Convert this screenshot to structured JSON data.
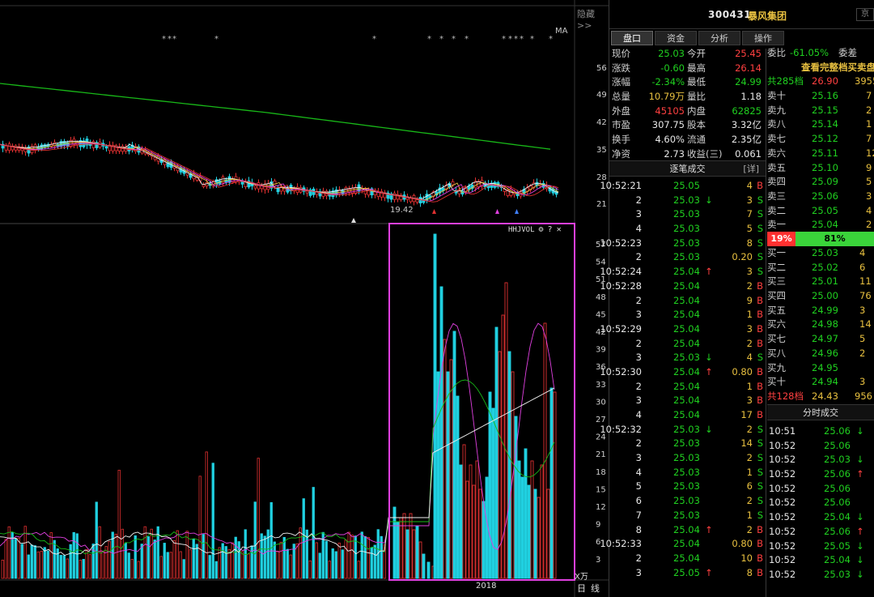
{
  "stock": {
    "code": "300431",
    "name": "暴风集团",
    "corner": "京"
  },
  "tabs": [
    "盘口",
    "资金",
    "分析",
    "操作"
  ],
  "quote": [
    {
      "l1": "现价",
      "v1": "25.03",
      "c1": "grn",
      "l2": "今开",
      "v2": "25.45",
      "c2": "red"
    },
    {
      "l1": "涨跌",
      "v1": "-0.60",
      "c1": "grn",
      "l2": "最高",
      "v2": "26.14",
      "c2": "red"
    },
    {
      "l1": "涨幅",
      "v1": "-2.34%",
      "c1": "grn",
      "l2": "最低",
      "v2": "24.99",
      "c2": "grn"
    },
    {
      "l1": "总量",
      "v1": "10.79万",
      "c1": "yel",
      "l2": "量比",
      "v2": "1.18",
      "c2": "wht"
    },
    {
      "l1": "外盘",
      "v1": "45105",
      "c1": "red",
      "l2": "内盘",
      "v2": "62825",
      "c2": "grn"
    },
    {
      "l1": "市盈",
      "v1": "307.75",
      "c1": "wht",
      "l2": "股本",
      "v2": "3.32亿",
      "c2": "wht"
    },
    {
      "l1": "换手",
      "v1": "4.60%",
      "c1": "wht",
      "l2": "流通",
      "v2": "2.35亿",
      "c2": "wht"
    },
    {
      "l1": "净资",
      "v1": "2.73",
      "c1": "wht",
      "l2": "收益(三)",
      "v2": "0.061",
      "c2": "wht"
    }
  ],
  "ticks_header": {
    "title": "逐笔成交",
    "detail": "[详]"
  },
  "ticks": [
    {
      "t": "10:52:21",
      "p": "25.05",
      "a": "",
      "v": "4",
      "s": "B"
    },
    {
      "t": "2",
      "p": "25.03",
      "a": "↓",
      "v": "3",
      "s": "S"
    },
    {
      "t": "3",
      "p": "25.03",
      "a": "",
      "v": "7",
      "s": "S"
    },
    {
      "t": "4",
      "p": "25.03",
      "a": "",
      "v": "5",
      "s": "S"
    },
    {
      "t": "10:52:23",
      "p": "25.03",
      "a": "",
      "v": "8",
      "s": "S"
    },
    {
      "t": "2",
      "p": "25.03",
      "a": "",
      "v": "0.20",
      "s": "S"
    },
    {
      "t": "10:52:24",
      "p": "25.04",
      "a": "↑",
      "v": "3",
      "s": "S"
    },
    {
      "t": "10:52:28",
      "p": "25.04",
      "a": "",
      "v": "2",
      "s": "B"
    },
    {
      "t": "2",
      "p": "25.04",
      "a": "",
      "v": "9",
      "s": "B"
    },
    {
      "t": "3",
      "p": "25.04",
      "a": "",
      "v": "1",
      "s": "B"
    },
    {
      "t": "10:52:29",
      "p": "25.04",
      "a": "",
      "v": "3",
      "s": "B"
    },
    {
      "t": "2",
      "p": "25.04",
      "a": "",
      "v": "2",
      "s": "B"
    },
    {
      "t": "3",
      "p": "25.03",
      "a": "↓",
      "v": "4",
      "s": "S"
    },
    {
      "t": "10:52:30",
      "p": "25.04",
      "a": "↑",
      "v": "0.80",
      "s": "B"
    },
    {
      "t": "2",
      "p": "25.04",
      "a": "",
      "v": "1",
      "s": "B"
    },
    {
      "t": "3",
      "p": "25.04",
      "a": "",
      "v": "3",
      "s": "B"
    },
    {
      "t": "4",
      "p": "25.04",
      "a": "",
      "v": "17",
      "s": "B"
    },
    {
      "t": "10:52:32",
      "p": "25.03",
      "a": "↓",
      "v": "2",
      "s": "S"
    },
    {
      "t": "2",
      "p": "25.03",
      "a": "",
      "v": "14",
      "s": "S"
    },
    {
      "t": "3",
      "p": "25.03",
      "a": "",
      "v": "2",
      "s": "S"
    },
    {
      "t": "4",
      "p": "25.03",
      "a": "",
      "v": "1",
      "s": "S"
    },
    {
      "t": "5",
      "p": "25.03",
      "a": "",
      "v": "6",
      "s": "S"
    },
    {
      "t": "6",
      "p": "25.03",
      "a": "",
      "v": "2",
      "s": "S"
    },
    {
      "t": "7",
      "p": "25.03",
      "a": "",
      "v": "1",
      "s": "S"
    },
    {
      "t": "8",
      "p": "25.04",
      "a": "↑",
      "v": "2",
      "s": "B"
    },
    {
      "t": "10:52:33",
      "p": "25.04",
      "a": "",
      "v": "0.80",
      "s": "B"
    },
    {
      "t": "2",
      "p": "25.04",
      "a": "",
      "v": "10",
      "s": "B"
    },
    {
      "t": "3",
      "p": "25.05",
      "a": "↑",
      "v": "8",
      "s": "B"
    }
  ],
  "orderbook": {
    "weibi": {
      "l1": "委比",
      "v1": "-61.05%",
      "l2": "委差"
    },
    "full_link": "查看完整档买卖盘",
    "sell_total": {
      "l": "共285档",
      "p": "26.90",
      "v": "3955"
    },
    "sells": [
      {
        "l": "卖十",
        "p": "25.16",
        "v": "7"
      },
      {
        "l": "卖九",
        "p": "25.15",
        "v": "2"
      },
      {
        "l": "卖八",
        "p": "25.14",
        "v": "1"
      },
      {
        "l": "卖七",
        "p": "25.12",
        "v": "7"
      },
      {
        "l": "卖六",
        "p": "25.11",
        "v": "12"
      },
      {
        "l": "卖五",
        "p": "25.10",
        "v": "9"
      },
      {
        "l": "卖四",
        "p": "25.09",
        "v": "5"
      },
      {
        "l": "卖三",
        "p": "25.06",
        "v": "3"
      },
      {
        "l": "卖二",
        "p": "25.05",
        "v": "4"
      },
      {
        "l": "卖一",
        "p": "25.04",
        "v": "2"
      }
    ],
    "ratio": {
      "red": "19%",
      "green": "81%"
    },
    "buys": [
      {
        "l": "买一",
        "p": "25.03",
        "v": "4"
      },
      {
        "l": "买二",
        "p": "25.02",
        "v": "6"
      },
      {
        "l": "买三",
        "p": "25.01",
        "v": "11"
      },
      {
        "l": "买四",
        "p": "25.00",
        "v": "76"
      },
      {
        "l": "买五",
        "p": "24.99",
        "v": "3"
      },
      {
        "l": "买六",
        "p": "24.98",
        "v": "14"
      },
      {
        "l": "买七",
        "p": "24.97",
        "v": "5"
      },
      {
        "l": "买八",
        "p": "24.96",
        "v": "2"
      },
      {
        "l": "买九",
        "p": "24.95",
        "v": ""
      },
      {
        "l": "买十",
        "p": "24.94",
        "v": "3"
      }
    ],
    "buy_total": {
      "l": "共128档",
      "p": "24.43",
      "v": "956"
    }
  },
  "fenshi_header": "分时成交",
  "fenshi": [
    {
      "t": "10:51",
      "p": "25.06",
      "a": "↓"
    },
    {
      "t": "10:52",
      "p": "25.06",
      "a": ""
    },
    {
      "t": "10:52",
      "p": "25.03",
      "a": "↓"
    },
    {
      "t": "10:52",
      "p": "25.06",
      "a": "↑"
    },
    {
      "t": "10:52",
      "p": "25.06",
      "a": ""
    },
    {
      "t": "10:52",
      "p": "25.06",
      "a": ""
    },
    {
      "t": "10:52",
      "p": "25.04",
      "a": "↓"
    },
    {
      "t": "10:52",
      "p": "25.06",
      "a": "↑"
    },
    {
      "t": "10:52",
      "p": "25.05",
      "a": "↓"
    },
    {
      "t": "10:52",
      "p": "25.04",
      "a": "↓"
    },
    {
      "t": "10:52",
      "p": "25.03",
      "a": "↓"
    }
  ],
  "chart": {
    "hide_label": "隐藏>>",
    "ma_label": "MA",
    "price_axis": [
      "56",
      "49",
      "42",
      "35",
      "28",
      "21"
    ],
    "low_label": "19.42",
    "vol_axis": [
      "57",
      "54",
      "51",
      "48",
      "45",
      "42",
      "39",
      "36",
      "33",
      "30",
      "27",
      "24",
      "21",
      "18",
      "15",
      "12",
      "9",
      "6",
      "3"
    ],
    "indicator": {
      "name": "HHJVOL",
      "gear": "⚙",
      "help": "?",
      "close": "✕"
    },
    "unit": "X万",
    "year": "2018",
    "period_tabs": [
      "日",
      "线"
    ],
    "colors": {
      "up": "#e03030",
      "down": "#20d0e0",
      "ma_long": "#18b818",
      "highlight": "#e040e0"
    }
  }
}
